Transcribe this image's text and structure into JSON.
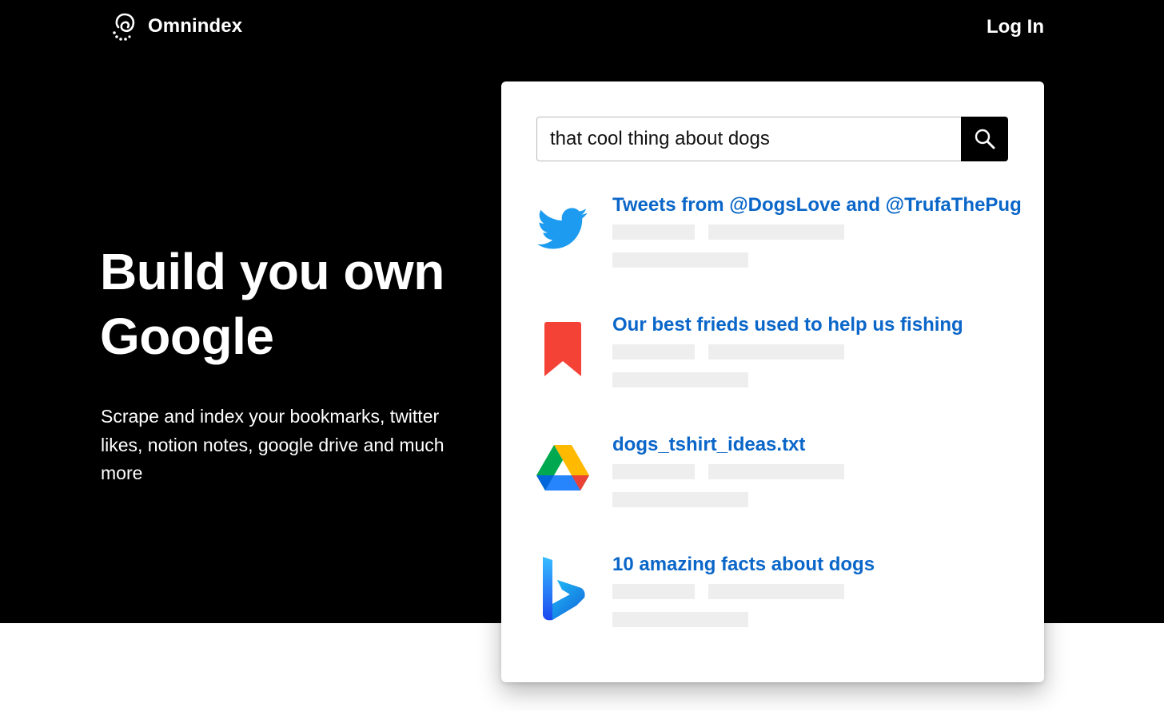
{
  "header": {
    "brand": "Omnindex",
    "login_label": "Log In"
  },
  "hero": {
    "headline": "Build you own Google",
    "subtext": "Scrape and index your bookmarks, twitter likes, notion notes, google drive and much more"
  },
  "search": {
    "query": "that cool thing about dogs"
  },
  "results": [
    {
      "source_icon": "twitter-icon",
      "title": "Tweets from @DogsLove and @TrufaThePug"
    },
    {
      "source_icon": "bookmark-icon",
      "title": "Our best frieds used to help us fishing"
    },
    {
      "source_icon": "google-drive-icon",
      "title": "dogs_tshirt_ideas.txt"
    },
    {
      "source_icon": "bing-icon",
      "title": "10 amazing facts about dogs"
    }
  ],
  "colors": {
    "hero_background": "#000000",
    "link": "#0a66c8",
    "twitter_blue": "#1d9bf0",
    "bookmark_red": "#f44336",
    "skeleton": "#eeeeee"
  }
}
